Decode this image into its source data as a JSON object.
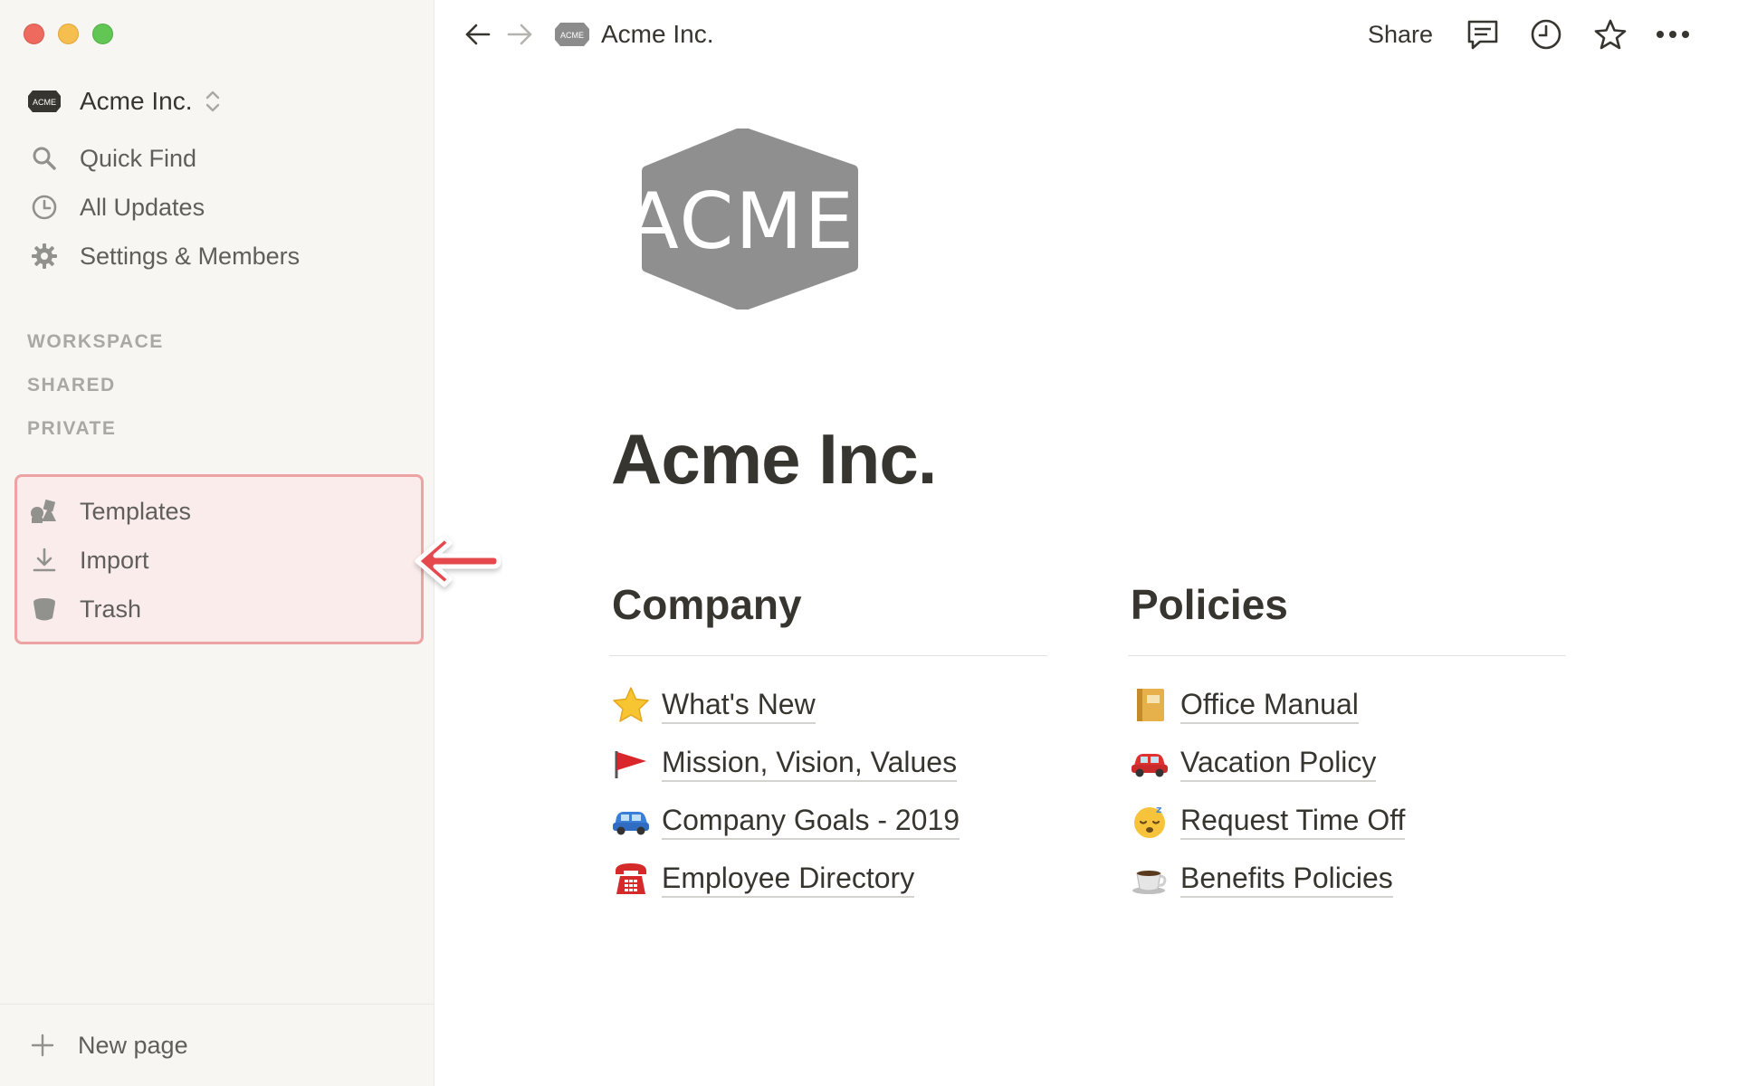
{
  "window": {
    "controls": [
      "close",
      "minimize",
      "zoom"
    ]
  },
  "sidebar": {
    "workspace_name": "Acme Inc.",
    "workspace_logo_text": "ACME",
    "nav_items": [
      {
        "label": "Quick Find",
        "icon": "search-icon"
      },
      {
        "label": "All Updates",
        "icon": "clock-icon"
      },
      {
        "label": "Settings & Members",
        "icon": "gear-icon"
      }
    ],
    "sections": [
      "WORKSPACE",
      "SHARED",
      "PRIVATE"
    ],
    "bottom_items": [
      {
        "label": "Templates",
        "icon": "templates-icon"
      },
      {
        "label": "Import",
        "icon": "download-icon"
      },
      {
        "label": "Trash",
        "icon": "trash-icon"
      }
    ],
    "new_page_label": "New page"
  },
  "topbar": {
    "breadcrumb": "Acme Inc.",
    "share_label": "Share"
  },
  "page": {
    "title": "Acme Inc.",
    "logo_text": "ACME",
    "columns": [
      {
        "heading": "Company",
        "links": [
          {
            "emoji": "star",
            "label": "What's New"
          },
          {
            "emoji": "red-flag",
            "label": "Mission, Vision, Values"
          },
          {
            "emoji": "blue-car",
            "label": "Company Goals - 2019"
          },
          {
            "emoji": "telephone",
            "label": "Employee Directory"
          }
        ]
      },
      {
        "heading": "Policies",
        "links": [
          {
            "emoji": "notebook",
            "label": "Office Manual"
          },
          {
            "emoji": "red-car",
            "label": "Vacation Policy"
          },
          {
            "emoji": "sleepy-face",
            "label": "Request Time Off"
          },
          {
            "emoji": "coffee-cup",
            "label": "Benefits Policies"
          }
        ]
      }
    ]
  },
  "colors": {
    "sidebar_bg": "#f7f6f3",
    "highlight_border": "#eda3a3",
    "highlight_fill": "#f9eceb",
    "arrow": "#e5484d",
    "text": "#37352f",
    "muted": "#a9a8a5"
  }
}
